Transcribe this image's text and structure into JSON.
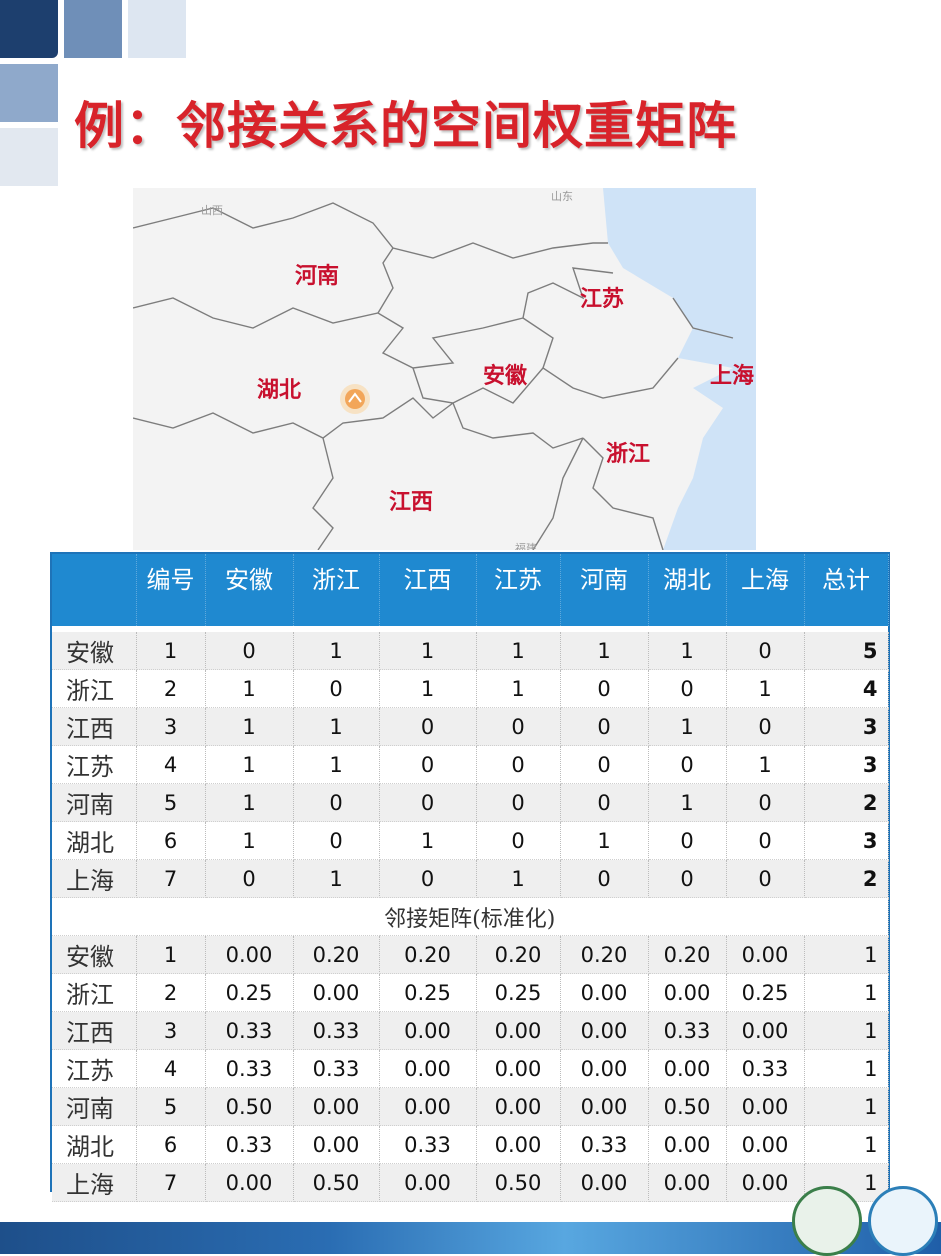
{
  "title": "例：邻接关系的空间权重矩阵",
  "map": {
    "labels": {
      "henan": "河南",
      "jiangsu": "江苏",
      "anhui": "安徽",
      "shanghai": "上海",
      "hubei": "湖北",
      "zhejiang": "浙江",
      "jiangxi": "江西"
    },
    "small_labels": {
      "shanxi": "山西",
      "shandong": "山东",
      "fujian": "福建"
    }
  },
  "table": {
    "headers": [
      "",
      "编号",
      "安徽",
      "浙江",
      "江西",
      "江苏",
      "河南",
      "湖北",
      "上海",
      "总计"
    ],
    "adjacency": [
      [
        "安徽",
        "1",
        "0",
        "1",
        "1",
        "1",
        "1",
        "1",
        "0",
        "5"
      ],
      [
        "浙江",
        "2",
        "1",
        "0",
        "1",
        "1",
        "0",
        "0",
        "1",
        "4"
      ],
      [
        "江西",
        "3",
        "1",
        "1",
        "0",
        "0",
        "0",
        "1",
        "0",
        "3"
      ],
      [
        "江苏",
        "4",
        "1",
        "1",
        "0",
        "0",
        "0",
        "0",
        "1",
        "3"
      ],
      [
        "河南",
        "5",
        "1",
        "0",
        "0",
        "0",
        "0",
        "1",
        "0",
        "2"
      ],
      [
        "湖北",
        "6",
        "1",
        "0",
        "1",
        "0",
        "1",
        "0",
        "0",
        "3"
      ],
      [
        "上海",
        "7",
        "0",
        "1",
        "0",
        "1",
        "0",
        "0",
        "0",
        "2"
      ]
    ],
    "caption": "邻接矩阵(标准化)",
    "standardized": [
      [
        "安徽",
        "1",
        "0.00",
        "0.20",
        "0.20",
        "0.20",
        "0.20",
        "0.20",
        "0.00",
        "1"
      ],
      [
        "浙江",
        "2",
        "0.25",
        "0.00",
        "0.25",
        "0.25",
        "0.00",
        "0.00",
        "0.25",
        "1"
      ],
      [
        "江西",
        "3",
        "0.33",
        "0.33",
        "0.00",
        "0.00",
        "0.00",
        "0.33",
        "0.00",
        "1"
      ],
      [
        "江苏",
        "4",
        "0.33",
        "0.33",
        "0.00",
        "0.00",
        "0.00",
        "0.00",
        "0.33",
        "1"
      ],
      [
        "河南",
        "5",
        "0.50",
        "0.00",
        "0.00",
        "0.00",
        "0.00",
        "0.50",
        "0.00",
        "1"
      ],
      [
        "湖北",
        "6",
        "0.33",
        "0.00",
        "0.33",
        "0.00",
        "0.33",
        "0.00",
        "0.00",
        "1"
      ],
      [
        "上海",
        "7",
        "0.00",
        "0.50",
        "0.00",
        "0.50",
        "0.00",
        "0.00",
        "0.00",
        "1"
      ]
    ]
  },
  "colors": {
    "title": "#d8232a",
    "header_bg": "#1f89d0",
    "map_label": "#c8102e",
    "sea": "#cfe3f7"
  }
}
